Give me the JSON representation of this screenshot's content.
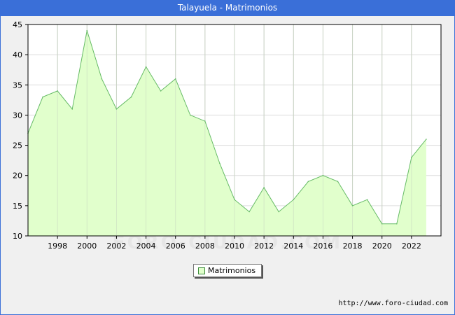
{
  "header": {
    "title": "Talayuela - Matrimonios"
  },
  "footer": {
    "source": "http://www.foro-ciudad.com",
    "watermark": "FORO-CIUDAD.COM"
  },
  "colors": {
    "accent": "#3a6fd8",
    "fill": "#e1ffcc",
    "line": "#66bb66"
  },
  "chart_data": {
    "type": "area",
    "title": "Talayuela - Matrimonios",
    "xlabel": "",
    "ylabel": "",
    "xlim": [
      1996,
      2024
    ],
    "ylim": [
      10,
      45
    ],
    "x_ticks": [
      "1998",
      "2000",
      "2002",
      "2004",
      "2006",
      "2008",
      "2010",
      "2012",
      "2014",
      "2016",
      "2018",
      "2020",
      "2022"
    ],
    "y_ticks": [
      "10",
      "15",
      "20",
      "25",
      "30",
      "35",
      "40",
      "45"
    ],
    "grid": true,
    "legend_position": "bottom-center",
    "series": [
      {
        "name": "Matrimonios",
        "x": [
          1996,
          1997,
          1998,
          1999,
          2000,
          2001,
          2002,
          2003,
          2004,
          2005,
          2006,
          2007,
          2008,
          2009,
          2010,
          2011,
          2012,
          2013,
          2014,
          2015,
          2016,
          2017,
          2018,
          2019,
          2020,
          2021,
          2022,
          2023
        ],
        "values": [
          27,
          33,
          34,
          31,
          44,
          36,
          31,
          33,
          38,
          34,
          36,
          30,
          29,
          22,
          16,
          14,
          18,
          14,
          16,
          19,
          20,
          19,
          15,
          16,
          12,
          12,
          23,
          26
        ]
      }
    ]
  }
}
